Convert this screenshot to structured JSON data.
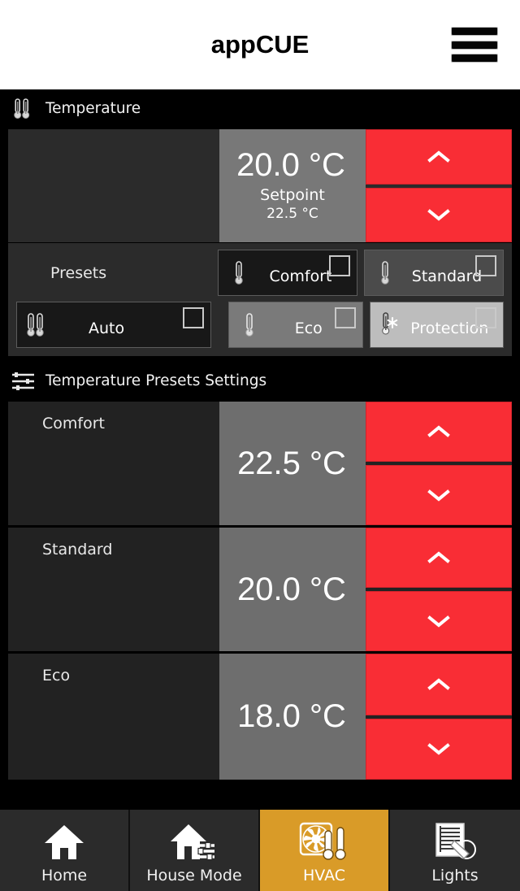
{
  "header": {
    "title": "appCUE",
    "menu_icon": "hamburger-menu-icon"
  },
  "temperature_section": {
    "header_label": "Temperature",
    "header_icon": "dual-thermometer-icon",
    "current": {
      "value": "20.0 °C",
      "setpoint_label": "Setpoint",
      "setpoint_value": "22.5 °C",
      "up_icon": "chevron-up-icon",
      "down_icon": "chevron-down-icon"
    },
    "presets_label": "Presets",
    "presets": [
      {
        "label": "Comfort",
        "icon": "thermometer-icon",
        "checked": false,
        "tone": "t-dark"
      },
      {
        "label": "Standard",
        "icon": "thermometer-icon",
        "checked": false,
        "tone": "t-mid"
      },
      {
        "label": "Auto",
        "icon": "dual-thermometer-icon",
        "checked": false,
        "tone": "t-dark"
      },
      {
        "label": "Eco",
        "icon": "thermometer-icon",
        "checked": false,
        "tone": "t-gray"
      },
      {
        "label": "Protection",
        "icon": "thermometer-snowflake-icon",
        "checked": false,
        "tone": "t-light"
      }
    ]
  },
  "settings_section": {
    "header_label": "Temperature Presets Settings",
    "header_icon": "sliders-settings-icon",
    "rows": [
      {
        "name": "Comfort",
        "value": "22.5 °C",
        "up_icon": "chevron-up-icon",
        "down_icon": "chevron-down-icon"
      },
      {
        "name": "Standard",
        "value": "20.0 °C",
        "up_icon": "chevron-up-icon",
        "down_icon": "chevron-down-icon"
      },
      {
        "name": "Eco",
        "value": "18.0 °C",
        "up_icon": "chevron-up-icon",
        "down_icon": "chevron-down-icon"
      }
    ]
  },
  "bottom_nav": {
    "items": [
      {
        "label": "Home",
        "icon": "house-icon",
        "active": false
      },
      {
        "label": "House Mode",
        "icon": "house-sliders-icon",
        "active": false
      },
      {
        "label": "HVAC",
        "icon": "fan-thermometers-icon",
        "active": true
      },
      {
        "label": "Lights",
        "icon": "blinds-light-icon",
        "active": false
      }
    ]
  },
  "colors": {
    "accent_red": "#f92d35",
    "active_orange": "#d99b28",
    "readout_gray": "#787878",
    "panel_dark": "#2b2b2b",
    "background": "#000000"
  }
}
